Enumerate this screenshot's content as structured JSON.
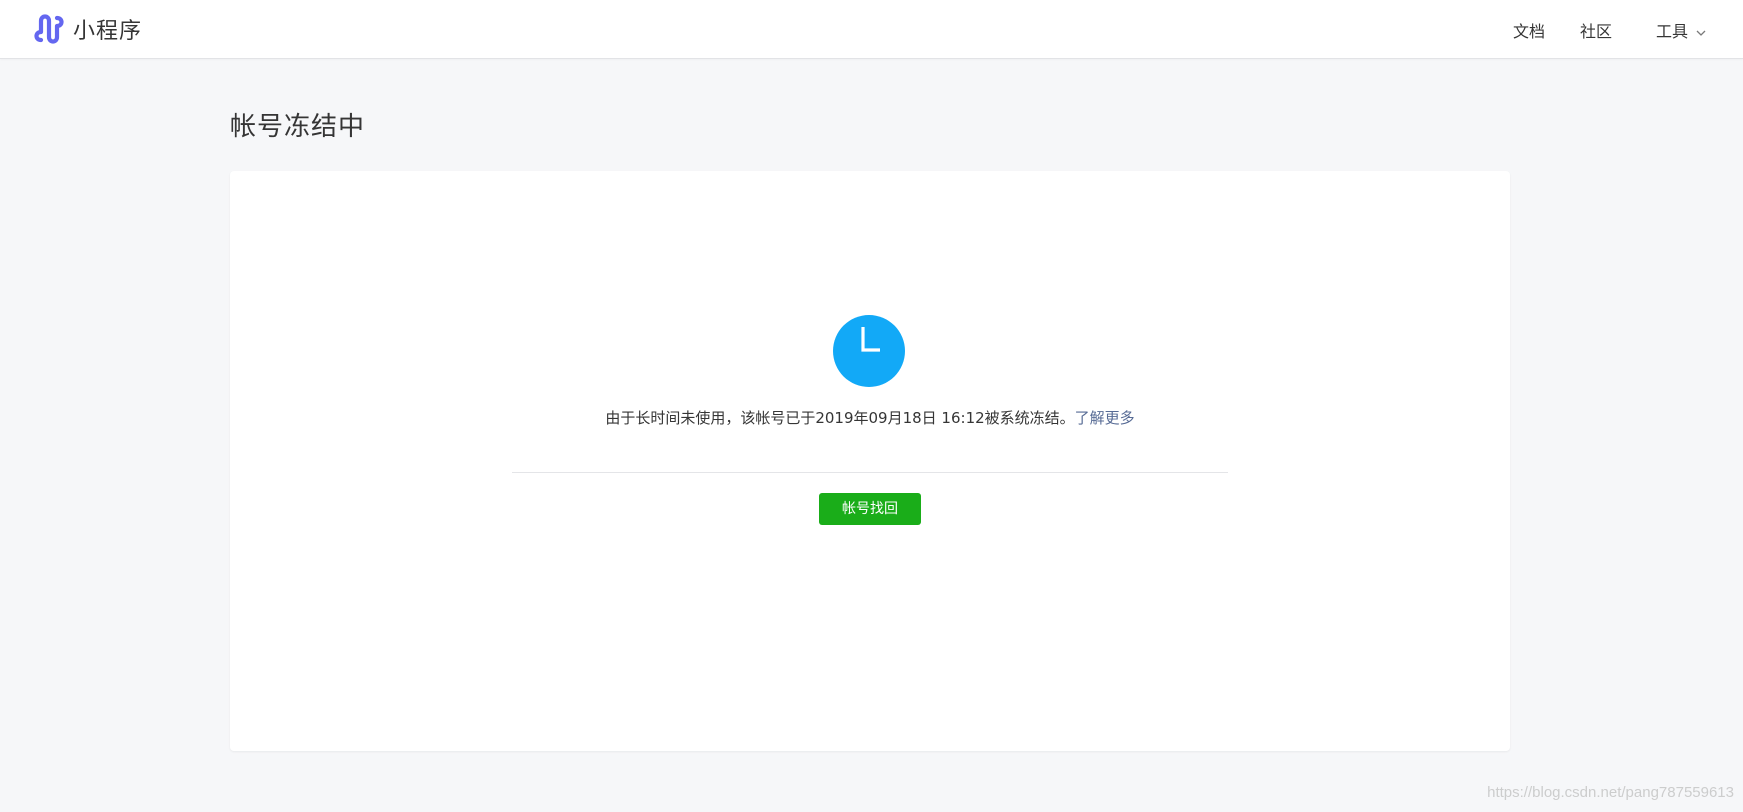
{
  "header": {
    "brand_name": "小程序",
    "brand_icon": "miniprogram-logo-icon",
    "brand_color": "#6467f0",
    "nav": {
      "docs": "文档",
      "community": "社区",
      "tools": "工具"
    },
    "tools_dropdown_icon": "chevron-down-icon"
  },
  "page": {
    "title": "帐号冻结中"
  },
  "status": {
    "icon": "clock-icon",
    "icon_color": "#12a9f7",
    "message": "由于长时间未使用，该帐号已于2019年09月18日 16:12被系统冻结。",
    "learn_more": "了解更多",
    "link_color": "#576b95"
  },
  "actions": {
    "recover_label": "帐号找回",
    "recover_color": "#1aad19"
  },
  "watermark": "https://blog.csdn.net/pang787559613"
}
